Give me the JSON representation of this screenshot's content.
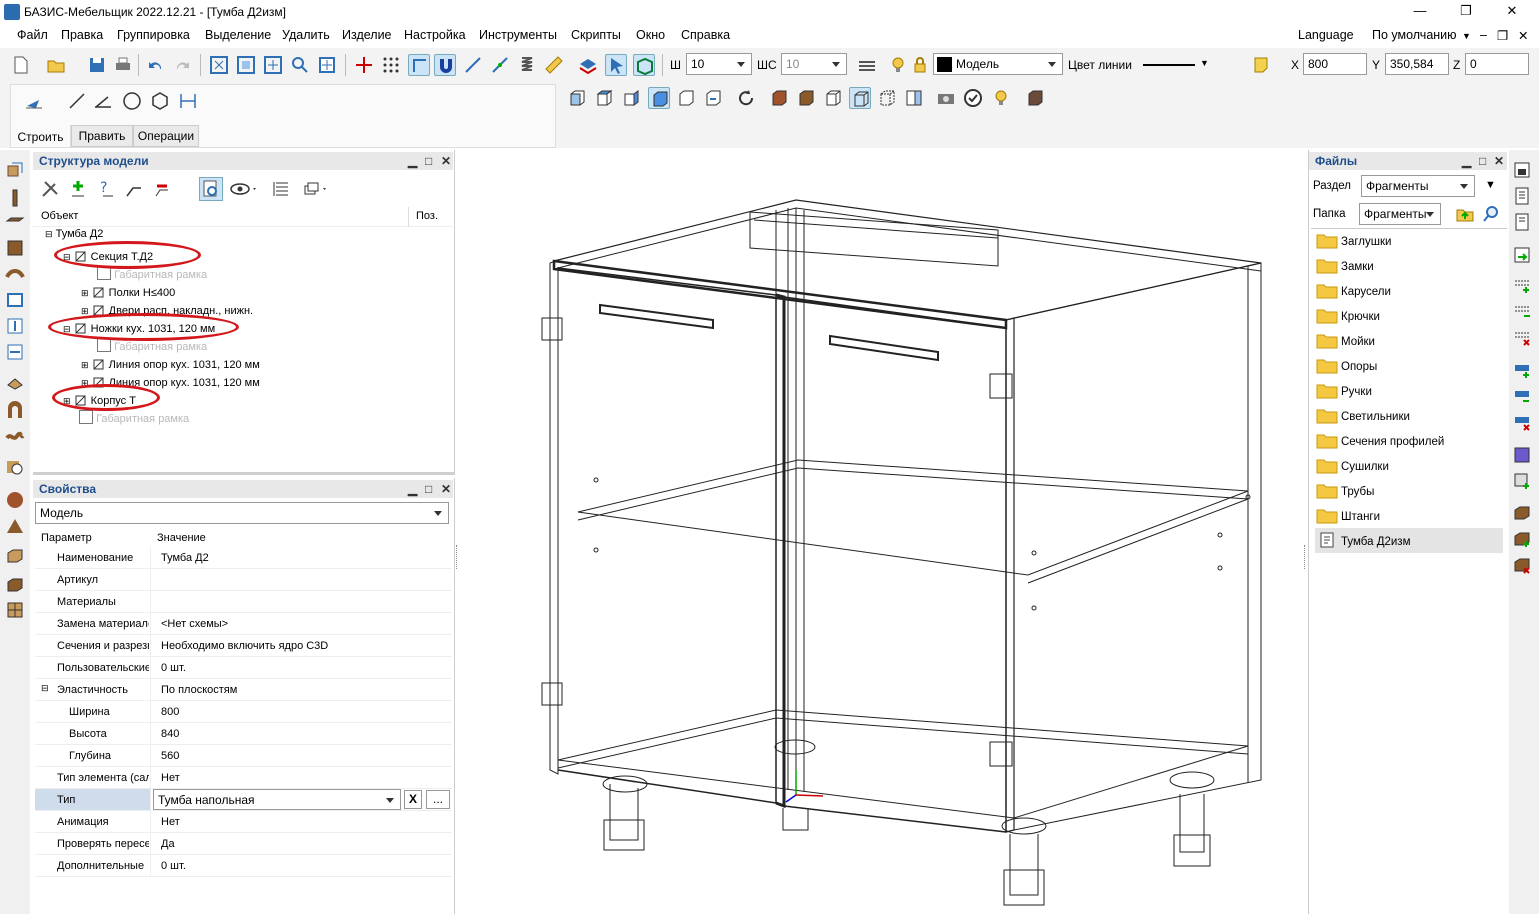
{
  "window": {
    "title": "БАЗИС-Мебельщик 2022.12.21 - [Тумба Д2изм]"
  },
  "menu": {
    "items": [
      "Файл",
      "Правка",
      "Группировка",
      "Выделение",
      "Удалить",
      "Изделие",
      "Настройка",
      "Инструменты",
      "Скрипты",
      "Окно",
      "Справка"
    ],
    "language": "Language",
    "default_profile": "По умолчанию"
  },
  "toolbar": {
    "sh_label": "Ш",
    "sh_value": "10",
    "shs_label": "ШС",
    "shs_value": "10",
    "layer_value": "Модель",
    "line_color_label": "Цвет линии",
    "x_label": "X",
    "x_value": "800",
    "y_label": "Y",
    "y_value": "350,584",
    "z_label": "Z",
    "z_value": "0"
  },
  "mode_tabs": [
    "Строить",
    "Править",
    "Операции"
  ],
  "structure_panel": {
    "title": "Структура модели",
    "col_object": "Объект",
    "col_pos": "Поз.",
    "tree": [
      {
        "label": "Тумба Д2",
        "level": 0,
        "dim": false
      },
      {
        "label": "Секция Т.Д2",
        "level": 1,
        "dim": false
      },
      {
        "label": "Габаритная рамка",
        "level": 2,
        "dim": true
      },
      {
        "label": "Полки H≤400",
        "level": 2,
        "dim": false
      },
      {
        "label": "Двери расп. накладн., нижн.",
        "level": 2,
        "dim": false
      },
      {
        "label": "Ножки кух. 1031, 120 мм",
        "level": 1,
        "dim": false
      },
      {
        "label": "Габаритная рамка",
        "level": 2,
        "dim": true
      },
      {
        "label": "Линия опор кух. 1031, 120 мм",
        "level": 2,
        "dim": false
      },
      {
        "label": "Линия опор кух. 1031, 120 мм",
        "level": 2,
        "dim": false
      },
      {
        "label": "Корпус Т",
        "level": 1,
        "dim": false
      },
      {
        "label": "Габаритная рамка",
        "level": 1,
        "dim": true
      }
    ]
  },
  "properties_panel": {
    "title": "Свойства",
    "selector": "Модель",
    "col_param": "Параметр",
    "col_value": "Значение",
    "rows": [
      {
        "name": "Наименование",
        "value": "Тумба Д2"
      },
      {
        "name": "Артикул",
        "value": ""
      },
      {
        "name": "Материалы",
        "value": ""
      },
      {
        "name": "Замена материалов",
        "value": "<Нет схемы>"
      },
      {
        "name": "Сечения и разрезы",
        "value": "Необходимо включить ядро C3D"
      },
      {
        "name": "Пользовательские",
        "value": "0 шт."
      },
      {
        "name": "Эластичность",
        "value": "По плоскостям"
      },
      {
        "name": "Ширина",
        "value": "800"
      },
      {
        "name": "Высота",
        "value": "840"
      },
      {
        "name": "Глубина",
        "value": "560"
      },
      {
        "name": "Тип элемента (сал",
        "value": "Нет"
      },
      {
        "name": "Тип",
        "value": "Тумба напольная"
      },
      {
        "name": "Анимация",
        "value": "Нет"
      },
      {
        "name": "Проверять пересе",
        "value": "Да"
      },
      {
        "name": "Дополнительные",
        "value": "0 шт."
      }
    ],
    "clear_btn": "X",
    "more_btn": "..."
  },
  "files_panel": {
    "title": "Файлы",
    "section_label": "Раздел",
    "section_value": "Фрагменты",
    "folder_label": "Папка",
    "folder_value": "Фрагменты",
    "items": [
      "Заглушки",
      "Замки",
      "Карусели",
      "Крючки",
      "Мойки",
      "Опоры",
      "Ручки",
      "Светильники",
      "Сечения профилей",
      "Сушилки",
      "Трубы",
      "Штанги",
      "Тумба Д2изм"
    ]
  },
  "colors": {
    "accent": "#1f4e8c",
    "highlight_ellipse": "#d3171b"
  }
}
